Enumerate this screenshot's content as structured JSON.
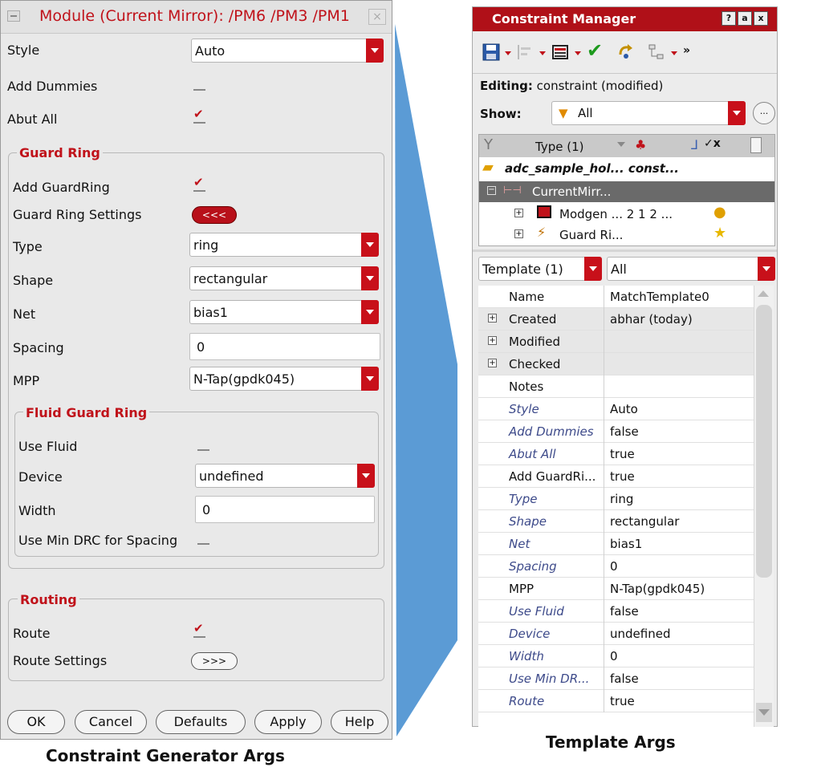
{
  "dialog": {
    "title": "Module (Current Mirror): /PM6 /PM3 /PM1",
    "close_glyph": "×",
    "style_label": "Style",
    "style_value": "Auto",
    "add_dummies_label": "Add Dummies",
    "abut_all_label": "Abut All",
    "guard_ring": {
      "title": "Guard Ring",
      "add_label": "Add GuardRing",
      "settings_label": "Guard Ring Settings",
      "settings_button": "<<<",
      "type_label": "Type",
      "type_value": "ring",
      "shape_label": "Shape",
      "shape_value": "rectangular",
      "net_label": "Net",
      "net_value": "bias1",
      "spacing_label": "Spacing",
      "spacing_value": "0",
      "mpp_label": "MPP",
      "mpp_value": "N-Tap(gpdk045)"
    },
    "fluid": {
      "title": "Fluid Guard Ring",
      "use_fluid_label": "Use Fluid",
      "device_label": "Device",
      "device_value": "undefined",
      "width_label": "Width",
      "width_value": "0",
      "min_drc_label": "Use Min DRC for Spacing"
    },
    "routing": {
      "title": "Routing",
      "route_label": "Route",
      "settings_label": "Route Settings",
      "settings_button": ">>>"
    },
    "buttons": {
      "ok": "OK",
      "cancel": "Cancel",
      "defaults": "Defaults",
      "apply": "Apply",
      "help": "Help"
    },
    "caption": "Constraint Generator Args"
  },
  "cm": {
    "title": "Constraint Manager",
    "win_buttons": [
      "?",
      "a",
      "x"
    ],
    "more_glyph": "»",
    "editing_label": "Editing:",
    "editing_value": "constraint (modified)",
    "show_label": "Show:",
    "show_value": "All",
    "show_more": "...",
    "tree": {
      "header": "Type (1)",
      "root": "adc_sample_hol...  const...",
      "selected": "CurrentMirr...",
      "child1": "Modgen ...  2 1 2 ...",
      "child2": "Guard Ri..."
    },
    "template_dropdown": "Template (1)",
    "filter_dropdown": "All",
    "grid_rows": [
      {
        "k": "Name",
        "v": "MatchTemplate0",
        "italic": false,
        "expand": false,
        "shade": false
      },
      {
        "k": "Created",
        "v": "abhar (today)",
        "italic": false,
        "expand": true,
        "shade": true
      },
      {
        "k": "Modified",
        "v": "",
        "italic": false,
        "expand": true,
        "shade": true
      },
      {
        "k": "Checked",
        "v": "",
        "italic": false,
        "expand": true,
        "shade": true
      },
      {
        "k": "Notes",
        "v": "",
        "italic": false,
        "expand": false,
        "shade": false
      },
      {
        "k": "Style",
        "v": "Auto",
        "italic": true,
        "expand": false,
        "shade": false
      },
      {
        "k": "Add Dummies",
        "v": "false",
        "italic": true,
        "expand": false,
        "shade": false
      },
      {
        "k": "Abut All",
        "v": "true",
        "italic": true,
        "expand": false,
        "shade": false
      },
      {
        "k": "Add GuardRi...",
        "v": "true",
        "italic": false,
        "expand": false,
        "shade": false
      },
      {
        "k": "Type",
        "v": "ring",
        "italic": true,
        "expand": false,
        "shade": false
      },
      {
        "k": "Shape",
        "v": "rectangular",
        "italic": true,
        "expand": false,
        "shade": false
      },
      {
        "k": "Net",
        "v": "bias1",
        "italic": true,
        "expand": false,
        "shade": false
      },
      {
        "k": "Spacing",
        "v": "0",
        "italic": true,
        "expand": false,
        "shade": false
      },
      {
        "k": "MPP",
        "v": "N-Tap(gpdk045)",
        "italic": false,
        "expand": false,
        "shade": false
      },
      {
        "k": "Use Fluid",
        "v": "false",
        "italic": true,
        "expand": false,
        "shade": false
      },
      {
        "k": "Device",
        "v": "undefined",
        "italic": true,
        "expand": false,
        "shade": false
      },
      {
        "k": "Width",
        "v": "0",
        "italic": true,
        "expand": false,
        "shade": false
      },
      {
        "k": "Use Min DR...",
        "v": "false",
        "italic": true,
        "expand": false,
        "shade": false
      },
      {
        "k": "Route",
        "v": "true",
        "italic": true,
        "expand": false,
        "shade": false
      }
    ],
    "caption": "Template Args"
  },
  "colors": {
    "accent_red": "#c0121a",
    "titlebar_red": "#b01018",
    "connector_blue": "#5b9bd5"
  }
}
